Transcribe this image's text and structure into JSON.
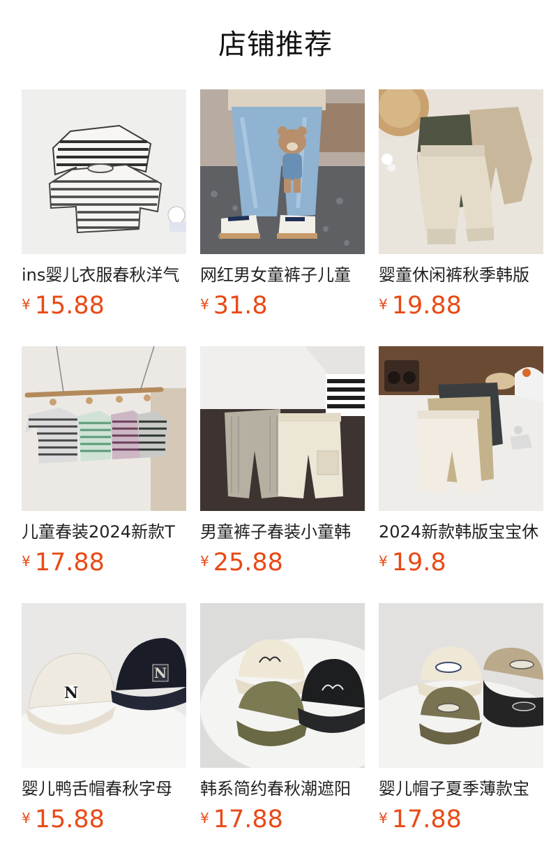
{
  "section_title": "店铺推荐",
  "colors": {
    "price": "#e84a16",
    "title": "#111111",
    "name": "#222222"
  },
  "products": [
    {
      "name": "ins婴儿衣服春秋洋气",
      "currency": "¥",
      "price": "15.88",
      "image": "striped-baby-tops"
    },
    {
      "name": "网红男女童裤子儿童",
      "currency": "¥",
      "price": "31.8",
      "image": "kids-jeans-with-teddy-bear"
    },
    {
      "name": "婴童休闲裤秋季韩版",
      "currency": "¥",
      "price": "19.88",
      "image": "baby-casual-pants"
    },
    {
      "name": "儿童春装2024新款T",
      "currency": "¥",
      "price": "17.88",
      "image": "striped-shirts-on-hangers"
    },
    {
      "name": "男童裤子春装小童韩",
      "currency": "¥",
      "price": "25.88",
      "image": "boys-cargo-pants"
    },
    {
      "name": "2024新款韩版宝宝休",
      "currency": "¥",
      "price": "19.8",
      "image": "stacked-baby-pants"
    },
    {
      "name": "婴儿鸭舌帽春秋字母",
      "currency": "¥",
      "price": "15.88",
      "image": "baby-caps-letter-n"
    },
    {
      "name": "韩系简约春秋潮遮阳",
      "currency": "¥",
      "price": "17.88",
      "image": "script-logo-caps"
    },
    {
      "name": "婴儿帽子夏季薄款宝",
      "currency": "¥",
      "price": "17.88",
      "image": "patch-logo-caps"
    }
  ]
}
